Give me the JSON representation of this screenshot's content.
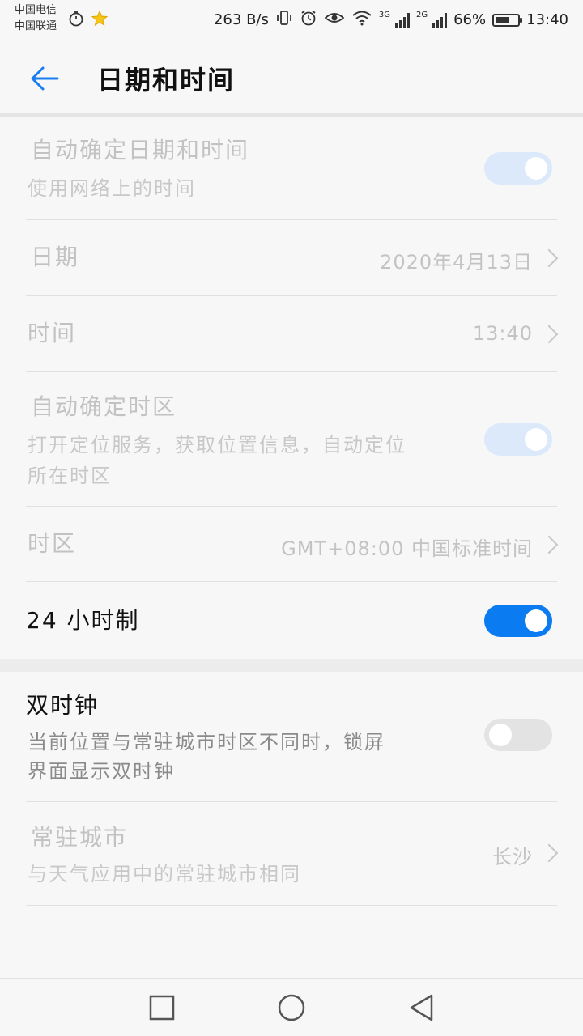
{
  "status_bar": {
    "carrier_1": "中国电信",
    "carrier_2": "中国联通",
    "net_speed": "263 B/s",
    "net_3g": "3G",
    "net_2g": "2G",
    "battery": "66%",
    "battery_level": 0.66,
    "time": "13:40"
  },
  "header": {
    "title": "日期和时间"
  },
  "settings": {
    "auto_datetime": {
      "title": "自动确定日期和时间",
      "subtitle": "使用网络上的时间",
      "state": "on",
      "enabled": false
    },
    "date": {
      "title": "日期",
      "value": "2020年4月13日"
    },
    "time": {
      "title": "时间",
      "value": "13:40"
    },
    "auto_timezone": {
      "title": "自动确定时区",
      "subtitle_line1": "打开定位服务，获取位置信息，自动定位",
      "subtitle_line2": "所在时区",
      "state": "on",
      "enabled": false
    },
    "timezone": {
      "title": "时区",
      "value": "GMT+08:00 中国标准时间"
    },
    "hour24": {
      "title": "24 小时制",
      "state": "on"
    },
    "dual_clock": {
      "title": "双时钟",
      "subtitle_line1": "当前位置与常驻城市时区不同时，锁屏",
      "subtitle_line2": "界面显示双时钟",
      "state": "off"
    },
    "home_city": {
      "title": "常驻城市",
      "subtitle": "与天气应用中的常驻城市相同",
      "value": "长沙"
    }
  },
  "colors": {
    "accent": "#0a7bf0",
    "disabled_toggle": "#dbe9fb",
    "off_toggle": "#e3e3e3"
  }
}
